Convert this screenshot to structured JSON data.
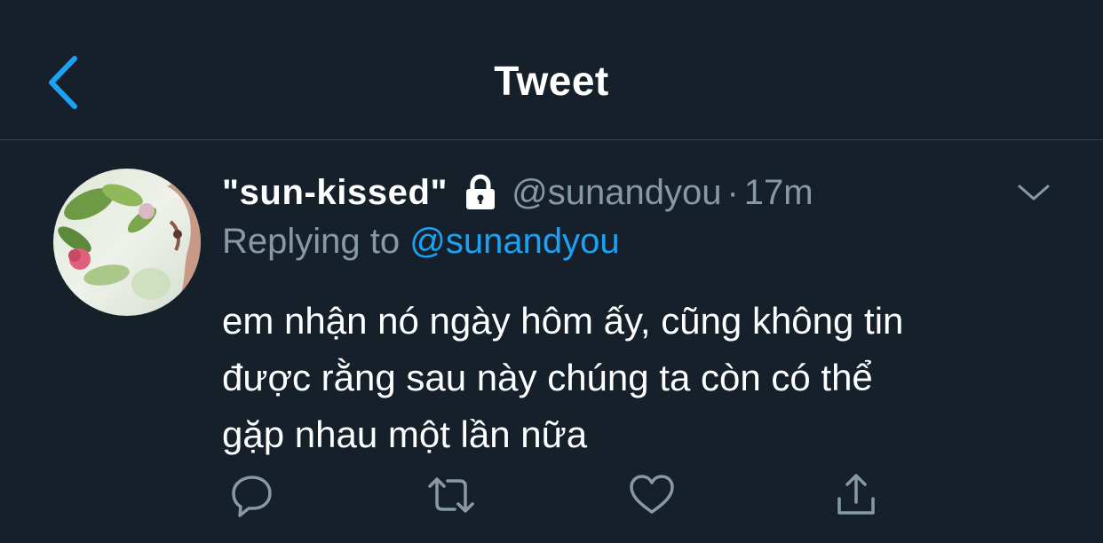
{
  "header": {
    "title": "Tweet",
    "back_icon": "chevron-left-icon"
  },
  "colors": {
    "background": "#15202b",
    "divider": "#38444d",
    "accent": "#1da1f2",
    "secondary_text": "#8899a6",
    "primary_text": "#ffffff"
  },
  "tweet": {
    "display_name": "\"sun-kissed\"",
    "protected_icon": "lock-icon",
    "handle": "@sunandyou",
    "separator": "·",
    "time": "17m",
    "menu_icon": "chevron-down-icon",
    "replying_prefix": "Replying to ",
    "replying_to": "@sunandyou",
    "text_lines": [
      "em nhận nó ngày hôm ấy, cũng không tin",
      "được rằng sau này chúng ta còn có thể",
      "gặp nhau một lần nữa"
    ]
  },
  "actions": [
    {
      "name": "reply",
      "icon": "reply-icon"
    },
    {
      "name": "retweet",
      "icon": "retweet-icon"
    },
    {
      "name": "like",
      "icon": "heart-icon"
    },
    {
      "name": "share",
      "icon": "share-icon"
    }
  ]
}
